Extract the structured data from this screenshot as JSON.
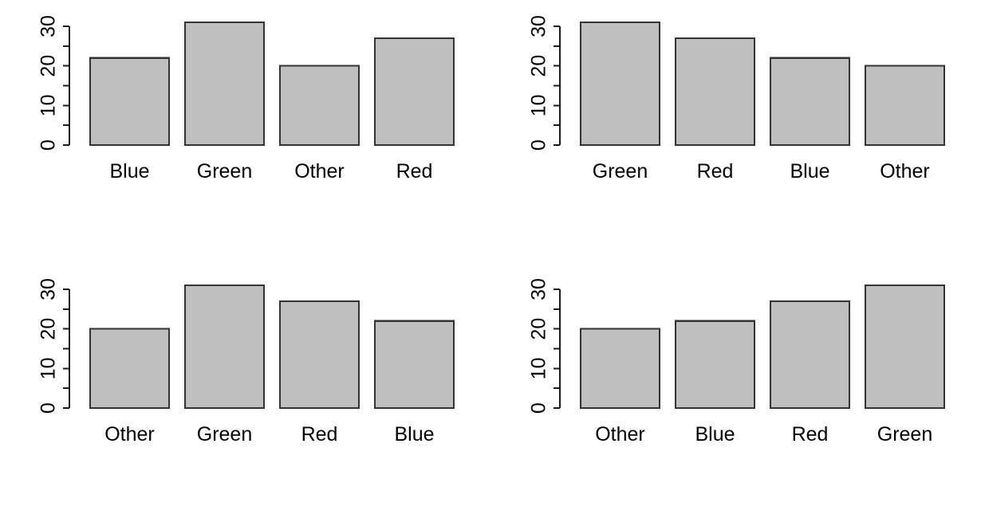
{
  "figure": {
    "background_color": "#ffffff",
    "layout": "2x2 panel grid",
    "panel_count": 4
  },
  "style": {
    "bar_fill": "#bfbfbf",
    "bar_border": "#333333",
    "axis_color": "#1a1a1a",
    "text_color": "#000000"
  },
  "chart_data": [
    {
      "type": "bar",
      "panel": "top-left",
      "title": "",
      "xlabel": "",
      "ylabel": "",
      "categories": [
        "Blue",
        "Green",
        "Other",
        "Red"
      ],
      "values": [
        22,
        31,
        20,
        27
      ],
      "ylim": [
        0,
        31
      ],
      "yticks": [
        0,
        5,
        10,
        15,
        20,
        25,
        30
      ],
      "ytick_labels": [
        "0",
        "",
        "10",
        "",
        "20",
        "",
        "30"
      ],
      "grid": false,
      "legend": "none",
      "sort_order": "alphabetical"
    },
    {
      "type": "bar",
      "panel": "top-right",
      "title": "",
      "xlabel": "",
      "ylabel": "",
      "categories": [
        "Green",
        "Red",
        "Blue",
        "Other"
      ],
      "values": [
        31,
        27,
        22,
        20
      ],
      "ylim": [
        0,
        31
      ],
      "yticks": [
        0,
        5,
        10,
        15,
        20,
        25,
        30
      ],
      "ytick_labels": [
        "0",
        "",
        "10",
        "",
        "20",
        "",
        "30"
      ],
      "grid": false,
      "legend": "none",
      "sort_order": "descending"
    },
    {
      "type": "bar",
      "panel": "bottom-left",
      "title": "",
      "xlabel": "",
      "ylabel": "",
      "categories": [
        "Other",
        "Green",
        "Red",
        "Blue"
      ],
      "values": [
        20,
        31,
        27,
        22
      ],
      "ylim": [
        0,
        31
      ],
      "yticks": [
        0,
        5,
        10,
        15,
        20,
        25,
        30
      ],
      "ytick_labels": [
        "0",
        "",
        "10",
        "",
        "20",
        "",
        "30"
      ],
      "grid": false,
      "legend": "none",
      "sort_order": "other-first"
    },
    {
      "type": "bar",
      "panel": "bottom-right",
      "title": "",
      "xlabel": "",
      "ylabel": "",
      "categories": [
        "Other",
        "Blue",
        "Red",
        "Green"
      ],
      "values": [
        20,
        22,
        27,
        31
      ],
      "ylim": [
        0,
        31
      ],
      "yticks": [
        0,
        5,
        10,
        15,
        20,
        25,
        30
      ],
      "ytick_labels": [
        "0",
        "",
        "10",
        "",
        "20",
        "",
        "30"
      ],
      "grid": false,
      "legend": "none",
      "sort_order": "ascending"
    }
  ]
}
